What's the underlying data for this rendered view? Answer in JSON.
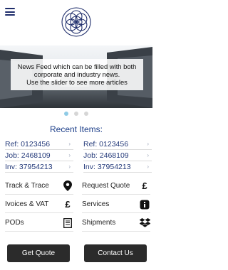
{
  "header": {
    "menu_icon": "hamburger-menu-icon",
    "logo_icon": "flower-of-life-logo"
  },
  "banner": {
    "line1": "News Feed which can be filled with both",
    "line2": "corporate and industry news.",
    "line3": "Use the slider to see more articles"
  },
  "slider": {
    "count": 3,
    "active_index": 0
  },
  "recent": {
    "title": "Recent Items:",
    "left": [
      {
        "label": "Ref: 0123456"
      },
      {
        "label": "Job: 2468109"
      },
      {
        "label": "Inv: 37954213"
      }
    ],
    "right": [
      {
        "label": "Ref: 0123456"
      },
      {
        "label": "Job: 2468109"
      },
      {
        "label": "Inv: 37954213"
      }
    ]
  },
  "menu": {
    "track": {
      "label": "Track & Trace",
      "icon": "map-pin-icon"
    },
    "quote": {
      "label": "Request Quote",
      "icon": "pound-sign-icon",
      "glyph": "£"
    },
    "invoices": {
      "label": "Ivoices & VAT",
      "icon": "pound-sign-icon",
      "glyph": "£"
    },
    "services": {
      "label": "Services",
      "icon": "info-icon",
      "glyph": "i"
    },
    "pods": {
      "label": "PODs",
      "icon": "document-icon"
    },
    "shipments": {
      "label": "Shipments",
      "icon": "dropbox-icon"
    }
  },
  "buttons": {
    "get_quote": "Get Quote",
    "contact": "Contact Us"
  },
  "colors": {
    "brand_blue": "#1e2d6b",
    "heading_blue": "#1d3f8a",
    "button_dark": "#2b2b2b",
    "active_dot": "#8fcbe6"
  }
}
